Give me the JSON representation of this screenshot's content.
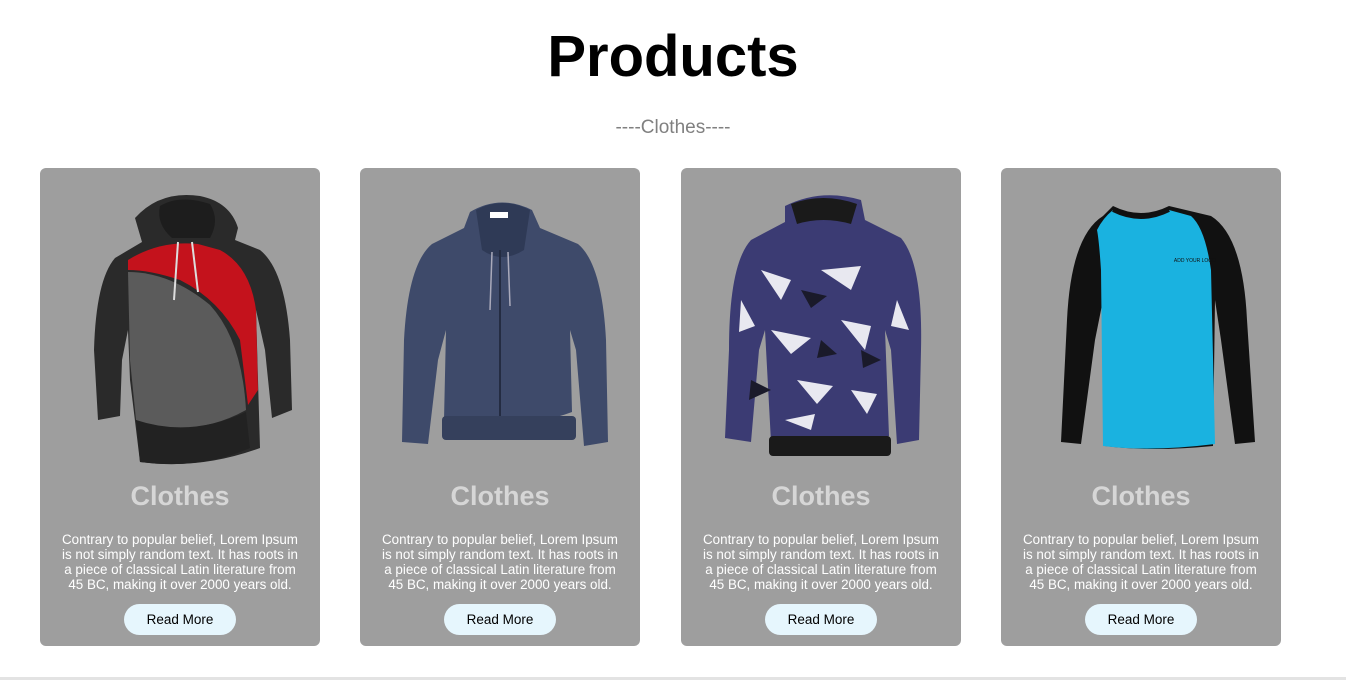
{
  "page": {
    "title": "Products",
    "subtitle": "----Clothes----"
  },
  "products": [
    {
      "image_icon": "two-tone-hoodie-icon",
      "title": "Clothes",
      "description": "Contrary to popular belief, Lorem Ipsum is not simply random text. It has roots in a piece of classical Latin literature from 45 BC, making it over 2000 years old.",
      "button_label": "Read More"
    },
    {
      "image_icon": "zip-hoodie-icon",
      "title": "Clothes",
      "description": "Contrary to popular belief, Lorem Ipsum is not simply random text. It has roots in a piece of classical Latin literature from 45 BC, making it over 2000 years old.",
      "button_label": "Read More"
    },
    {
      "image_icon": "camo-jacket-icon",
      "title": "Clothes",
      "description": "Contrary to popular belief, Lorem Ipsum is not simply random text. It has roots in a piece of classical Latin literature from 45 BC, making it over 2000 years old.",
      "button_label": "Read More"
    },
    {
      "image_icon": "raglan-shirt-icon",
      "title": "Clothes",
      "description": "Contrary to popular belief, Lorem Ipsum is not simply random text. It has roots in a piece of classical Latin literature from 45 BC, making it over 2000 years old.",
      "button_label": "Read More",
      "shirt_print": "ADD YOUR LOGO"
    }
  ],
  "colors": {
    "card_background": "#9e9e9e",
    "card_title": "#d6d6d6",
    "button_background": "#e6f6fd",
    "subtitle": "#808080"
  }
}
